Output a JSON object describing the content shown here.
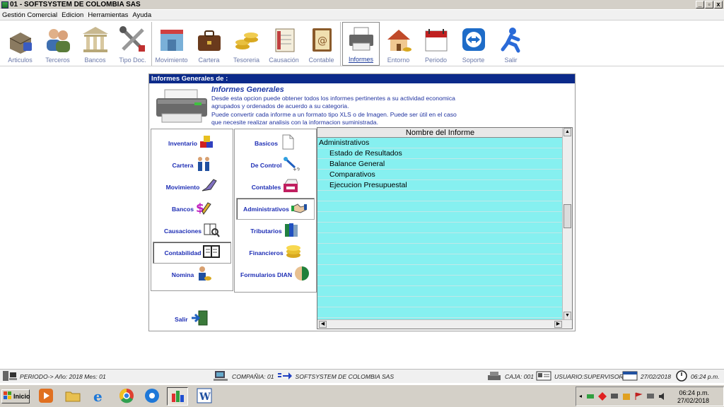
{
  "window": {
    "title": "01 - SOFTSYSTEM DE COLOMBIA SAS",
    "minimize": "_",
    "restore": "▫",
    "close": "x"
  },
  "menu": [
    "Gestión Comercial",
    "Edicion",
    "Herramientas",
    "Ayuda"
  ],
  "toolbar": {
    "group1": [
      "Articulos",
      "Terceros",
      "Bancos",
      "Tipo Doc."
    ],
    "group2": [
      "Movimiento",
      "Cartera",
      "Tesoreria",
      "Causación",
      "Contable"
    ],
    "group3": [
      "Informes",
      "Entorno",
      "Periodo",
      "Soporte",
      "Salir"
    ],
    "active": "Informes"
  },
  "panel": {
    "header": "Informes Generales de :",
    "info_title": "Informes Generales",
    "info_lines": [
      "Desde esta opcion puede obtener todos los informes pertinentes a su actividad economica",
      "agrupados y ordenados de acuerdo a su categoria.",
      "Puede convertir cada informe a un formato tipo XLS o de Imagen. Puede ser útil en el caso",
      "que necesite realizar analisis con la informacion suministrada."
    ]
  },
  "categories_left": [
    {
      "label": "Inventario",
      "icon": "cubes-icon"
    },
    {
      "label": "Cartera",
      "icon": "people-icon"
    },
    {
      "label": "Movimiento",
      "icon": "pen-icon"
    },
    {
      "label": "Bancos",
      "icon": "dollar-icon"
    },
    {
      "label": "Causaciones",
      "icon": "book-search-icon"
    },
    {
      "label": "Contabilidad",
      "icon": "ledger-icon"
    },
    {
      "label": "Nomina",
      "icon": "worker-icon"
    }
  ],
  "categories_right": [
    {
      "label": "Basicos",
      "icon": "document-icon"
    },
    {
      "label": "De Control",
      "icon": "control-icon"
    },
    {
      "label": "Contables",
      "icon": "cashbox-icon"
    },
    {
      "label": "Administrativos",
      "icon": "handshake-icon"
    },
    {
      "label": "Tributarios",
      "icon": "books-icon"
    },
    {
      "label": "Financieros",
      "icon": "coins-icon"
    },
    {
      "label": "Formularios DIAN",
      "icon": "dian-icon"
    }
  ],
  "active_left": "Contabilidad",
  "active_right": "Administrativos",
  "grid": {
    "header": "Nombre del Informe",
    "rows": [
      {
        "text": "Administrativos",
        "level": 0
      },
      {
        "text": "Estado de Resultados",
        "level": 1
      },
      {
        "text": "Balance General",
        "level": 1
      },
      {
        "text": "Comparativos",
        "level": 1
      },
      {
        "text": "Ejecucion Presupuestal",
        "level": 1
      }
    ]
  },
  "salir": "Salir",
  "status": {
    "periodo": "PERIODO-> Año: 2018  Mes: 01",
    "compania": "COMPAÑIA: 01",
    "compania_name": "SOFTSYSTEM DE COLOMBIA SAS",
    "caja": "CAJA: 001",
    "usuario": "USUARIO:SUPERVISOR",
    "fecha": "27/02/2018",
    "hora": "06:24 p.m."
  },
  "taskbar": {
    "start": "Inicio",
    "clock_time": "06:24 p.m.",
    "clock_date": "27/02/2018"
  },
  "colors": {
    "header_blue": "#0b2a8a",
    "grid_cyan": "#86f0f0",
    "link_blue": "#1f2fb5"
  }
}
